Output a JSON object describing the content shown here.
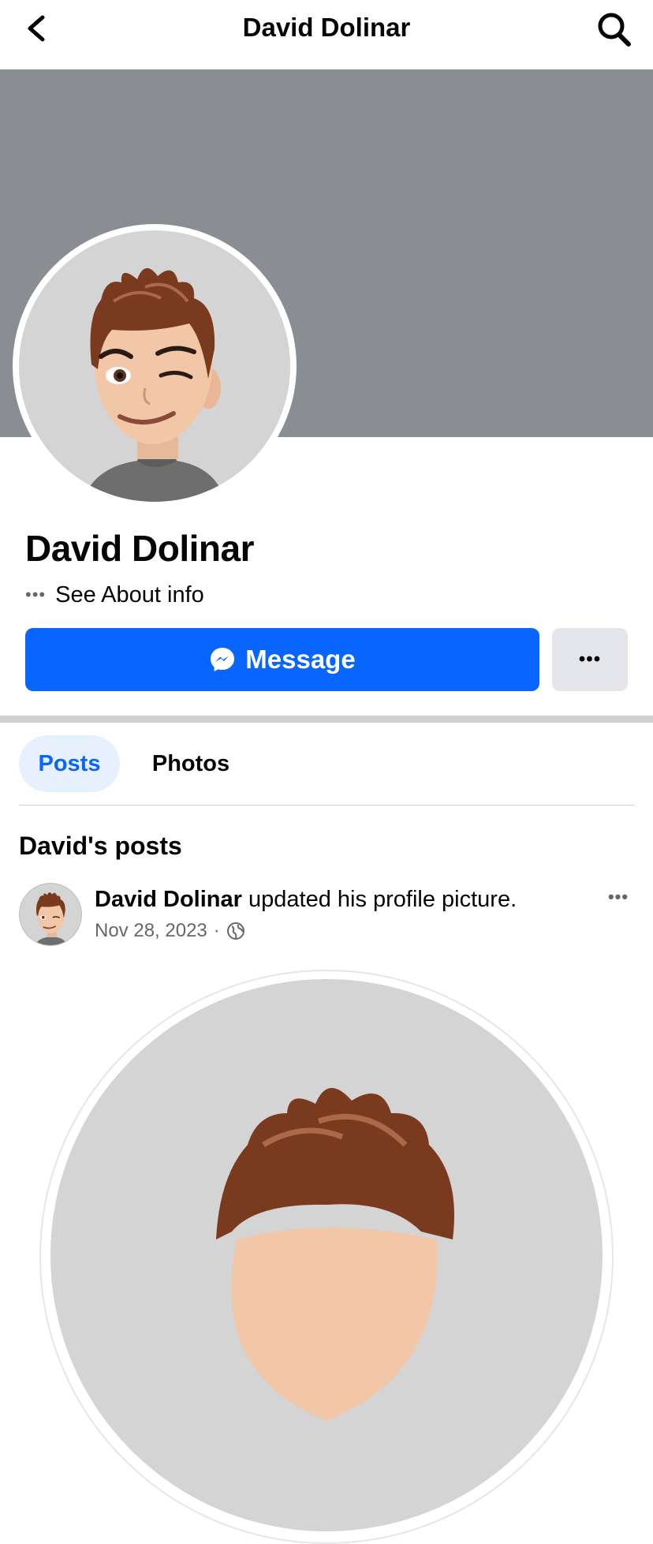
{
  "header": {
    "title": "David Dolinar",
    "back_icon": "chevron-left-icon",
    "search_icon": "search-icon"
  },
  "profile": {
    "name": "David Dolinar",
    "about_dots": "•••",
    "about_label": "See About info",
    "message_label": "Message",
    "message_icon": "messenger-icon",
    "more_label": "•••",
    "cover_color": "#8a8d91",
    "accent": "#0866ff"
  },
  "tabs": [
    {
      "label": "Posts",
      "active": true
    },
    {
      "label": "Photos",
      "active": false
    }
  ],
  "posts_section": {
    "title": "David's posts"
  },
  "post": {
    "author": "David Dolinar",
    "action": " updated his profile picture.",
    "date": "Nov 28, 2023",
    "separator": "·",
    "audience_icon": "globe-icon",
    "options_label": "•••"
  }
}
